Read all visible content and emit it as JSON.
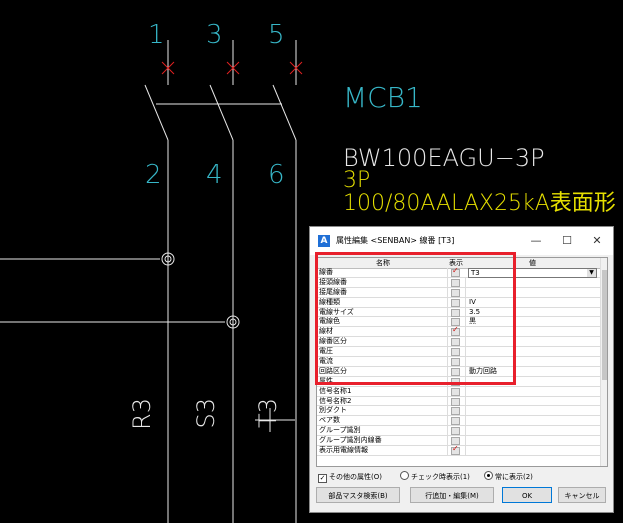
{
  "cad": {
    "terminal_top": [
      "1",
      "3",
      "5"
    ],
    "terminal_bottom": [
      "2",
      "4",
      "6"
    ],
    "device_name": "MCB1",
    "model": "BW100EAGU−3P",
    "poles": "3P",
    "rating": "100/80AALAX25kA表面形",
    "phase_labels": [
      "R3",
      "S3",
      "T3"
    ],
    "colors": {
      "cyan": "#37b7c8",
      "white": "#e8e8e8",
      "yellow": "#e6e000",
      "red": "#e8202c"
    }
  },
  "dialog": {
    "title": "属性編集 <SENBAN> 線番 [T3]",
    "minimize": "—",
    "maximize": "☐",
    "close": "✕",
    "columns": {
      "name": "名称",
      "display": "表示",
      "value": "値"
    },
    "dropdown_value": "T3",
    "rows": [
      {
        "name": "線番",
        "checked": true,
        "value": ""
      },
      {
        "name": "接頭線番",
        "checked": false,
        "value": ""
      },
      {
        "name": "接尾線番",
        "checked": false,
        "value": ""
      },
      {
        "name": "線種類",
        "checked": false,
        "value": "IV"
      },
      {
        "name": "電線サイズ",
        "checked": false,
        "value": "3.5"
      },
      {
        "name": "電線色",
        "checked": false,
        "value": "黒"
      },
      {
        "name": "線材",
        "checked": true,
        "value": ""
      },
      {
        "name": "線番区分",
        "checked": false,
        "value": ""
      },
      {
        "name": "電圧",
        "checked": false,
        "value": ""
      },
      {
        "name": "電流",
        "checked": false,
        "value": ""
      },
      {
        "name": "回路区分",
        "checked": false,
        "value": "動力回路"
      },
      {
        "name": "属性",
        "checked": false,
        "value": ""
      },
      {
        "name": "信号名称1",
        "checked": false,
        "value": ""
      },
      {
        "name": "信号名称2",
        "checked": false,
        "value": ""
      },
      {
        "name": "別ダクト",
        "checked": false,
        "value": ""
      },
      {
        "name": "ペア数",
        "checked": false,
        "value": ""
      },
      {
        "name": "グループ識別",
        "checked": false,
        "value": ""
      },
      {
        "name": "グループ識別内線番",
        "checked": false,
        "value": ""
      },
      {
        "name": "表示用電線情報",
        "checked": true,
        "value": ""
      }
    ],
    "other_attr_label": "その他の属性(O)",
    "radio_checked_label": "チェック時表示(1)",
    "radio_always_label": "常に表示(2)",
    "buttons": {
      "parts_search": "部品マスタ検索(B)",
      "row_add_edit": "行追加・編集(M)",
      "ok": "OK",
      "cancel": "キャンセル"
    }
  }
}
